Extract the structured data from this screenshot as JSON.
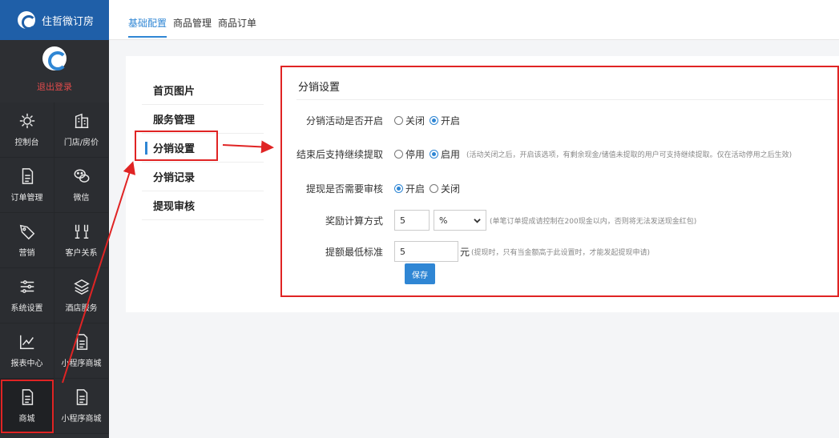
{
  "brand": {
    "name": "住哲微订房"
  },
  "user": {
    "logout": "退出登录"
  },
  "sidebar": {
    "items": [
      {
        "label": "控制台",
        "icon": "gear-icon"
      },
      {
        "label": "门店/房价",
        "icon": "building-icon"
      },
      {
        "label": "订单管理",
        "icon": "document-icon"
      },
      {
        "label": "微信",
        "icon": "wechat-icon"
      },
      {
        "label": "营销",
        "icon": "tag-icon"
      },
      {
        "label": "客户关系",
        "icon": "glasses-icon"
      },
      {
        "label": "系统设置",
        "icon": "sliders-icon"
      },
      {
        "label": "酒店服务",
        "icon": "layers-icon"
      },
      {
        "label": "报表中心",
        "icon": "chart-icon"
      },
      {
        "label": "小程序商城",
        "icon": "document-icon"
      },
      {
        "label": "商城",
        "icon": "document-icon"
      },
      {
        "label": "小程序商城",
        "icon": "document-icon"
      }
    ]
  },
  "tabs": [
    {
      "label": "基础配置"
    },
    {
      "label": "商品管理"
    },
    {
      "label": "商品订单"
    }
  ],
  "subnav": [
    {
      "label": "首页图片"
    },
    {
      "label": "服务管理"
    },
    {
      "label": "分销设置"
    },
    {
      "label": "分销记录"
    },
    {
      "label": "提现审核"
    }
  ],
  "form": {
    "title": "分销设置",
    "enable": {
      "label": "分销活动是否开启",
      "options": [
        "关闭",
        "开启"
      ],
      "selected": "开启"
    },
    "continue": {
      "label": "结束后支持继续提取",
      "options": [
        "停用",
        "启用"
      ],
      "selected": "启用",
      "hint": "(活动关闭之后，开启该选项，有剩余现金/储值未提取的用户可支持继续提取。仅在活动停用之后生效)"
    },
    "audit": {
      "label": "提现是否需要审核",
      "options": [
        "开启",
        "关闭"
      ],
      "selected": "开启"
    },
    "reward": {
      "label": "奖励计算方式",
      "value": "5",
      "unit": "%",
      "hint": "(单笔订单提成请控制在200现金以内，否则将无法发送现金红包)"
    },
    "minimum": {
      "label": "提额最低标准",
      "value": "5",
      "unit": "元",
      "hint": "(提现时，只有当金额高于此设置时，才能发起提现申请)"
    },
    "save": "保存"
  },
  "colors": {
    "accent": "#2f86d4",
    "highlight": "#e02424",
    "sidebar": "#2d2f33",
    "brand": "#1f5fa8"
  }
}
